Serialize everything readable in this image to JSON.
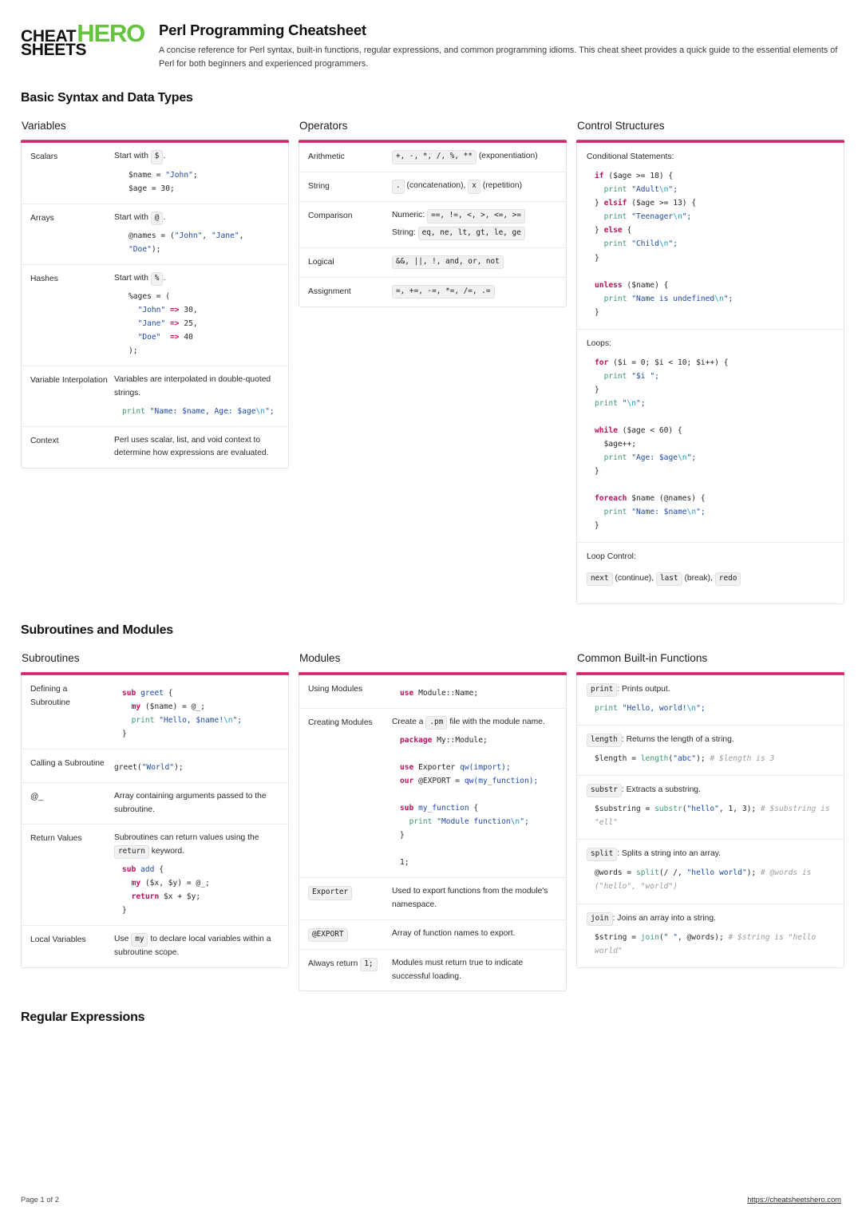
{
  "brand": {
    "logo_line1_dark": "CHEAT",
    "logo_line2_dark": "SHEETS",
    "logo_hero": "HERO",
    "green": "#66c340",
    "accent": "#cf1665"
  },
  "header": {
    "title": "Perl Programming Cheatsheet",
    "subtitle": "A concise reference for Perl syntax, built-in functions, regular expressions, and common programming idioms. This cheat sheet provides a quick guide to the essential elements of Perl for both beginners and experienced programmers."
  },
  "sections": [
    {
      "title": "Basic Syntax and Data Types"
    },
    {
      "title": "Subroutines and Modules"
    },
    {
      "title": "Regular Expressions"
    }
  ],
  "cards": {
    "variables": {
      "title": "Variables",
      "rows": {
        "scalars": {
          "label": "Scalars",
          "lead_prefix": "Start with",
          "lead_badge": "$",
          "lead_suffix": ".",
          "code_line1_var": "$name = ",
          "code_line1_str": "\"John\"",
          "code_line1_end": ";",
          "code_line2": "$age = 30;"
        },
        "arrays": {
          "label": "Arrays",
          "lead_prefix": "Start with",
          "lead_badge": "@",
          "lead_suffix": ".",
          "code_pre": "@names = (",
          "s1": "\"John\"",
          "sep1": ", ",
          "s2": "\"Jane\"",
          "sep2": ",",
          "s3": "\"Doe\"",
          "code_end": ");"
        },
        "hashes": {
          "label": "Hashes",
          "lead_prefix": "Start with",
          "lead_badge": "%",
          "lead_suffix": ".",
          "open": "%ages = (",
          "k1": "\"John\"",
          "v1": "30,",
          "k2": "\"Jane\"",
          "v2": "25,",
          "k3": "\"Doe\"",
          "v3": "40",
          "arrow": "=>",
          "close": ");"
        },
        "interpolation": {
          "label": "Variable Interpolation",
          "text": "Variables are interpolated in double-quoted strings.",
          "code_fn": "print",
          "code_str_a": "\"Name: $name, Age: $age",
          "code_esc": "\\n",
          "code_str_b": "\";"
        },
        "context": {
          "label": "Context",
          "text": "Perl uses scalar, list, and void context to determine how expressions are evaluated."
        }
      }
    },
    "operators": {
      "title": "Operators",
      "rows": {
        "arithmetic": {
          "label": "Arithmetic",
          "badge": "+, -, *, /, %, **",
          "after": "(exponentiation)"
        },
        "string": {
          "label": "String",
          "badge1": ".",
          "mid": "(concatenation),",
          "badge2": "x",
          "after": "(repetition)"
        },
        "comparison": {
          "label": "Comparison",
          "numeric_label": "Numeric:",
          "numeric_badge": "==, !=, <, >, <=, >=",
          "string_label": "String:",
          "string_badge": "eq, ne, lt, gt, le, ge"
        },
        "logical": {
          "label": "Logical",
          "badge": "&&, ||, !, and, or, not"
        },
        "assignment": {
          "label": "Assignment",
          "badge": "=, +=, -=, *=, /=, .="
        }
      }
    },
    "control": {
      "title": "Control Structures",
      "conditional": {
        "label": "Conditional Statements:",
        "if_kw": "if",
        "if_cond": " ($age >= 18) {",
        "p1_fn": "print",
        "p1_str": "\"Adult",
        "p1_esc": "\\n",
        "p1_end": "\";",
        "elsif_pre": "} ",
        "elsif_kw": "elsif",
        "elsif_cond": " ($age >= 13) {",
        "p2_fn": "print",
        "p2_str": "\"Teenager",
        "p2_esc": "\\n",
        "p2_end": "\";",
        "else_pre": "} ",
        "else_kw": "else",
        "else_post": " {",
        "p3_fn": "print",
        "p3_str": "\"Child",
        "p3_esc": "\\n",
        "p3_end": "\";",
        "brace": "}",
        "unless_kw": "unless",
        "unless_cond": " ($name) {",
        "p4_fn": "print",
        "p4_str": "\"Name is undefined",
        "p4_esc": "\\n",
        "p4_end": "\";",
        "brace2": "}"
      },
      "loops": {
        "label": "Loops:",
        "for_kw": "for",
        "for_cond": " ($i = 0; $i < 10; $i++) {",
        "for_fn": "print",
        "for_str": "\"$i \";",
        "for_close": "}",
        "print_fn": "print",
        "print_str": "\"",
        "print_esc": "\\n",
        "print_end": "\";",
        "while_kw": "while",
        "while_cond": " ($age < 60) {",
        "while_inc": "$age++;",
        "while_fn": "print",
        "while_str": "\"Age: $age",
        "while_esc": "\\n",
        "while_end": "\";",
        "while_close": "}",
        "foreach_kw": "foreach",
        "foreach_cond": " $name (@names) {",
        "foreach_fn": "print",
        "foreach_str": "\"Name: $name",
        "foreach_esc": "\\n",
        "foreach_end": "\";",
        "foreach_close": "}"
      },
      "loop_control": {
        "label": "Loop Control:",
        "b1": "next",
        "t1": "(continue),",
        "b2": "last",
        "t2": "(break),",
        "b3": "redo"
      }
    },
    "subroutines": {
      "title": "Subroutines",
      "rows": {
        "defining": {
          "label": "Defining a Subroutine",
          "sub_kw": "sub",
          "sub_name": " greet",
          "sub_open": " {",
          "my_kw": "my",
          "my_rest": " ($name) = @_;",
          "print_fn": "print",
          "print_str": " \"Hello, $name!",
          "print_esc": "\\n",
          "print_end": "\";",
          "close": "}"
        },
        "calling": {
          "label": "Calling a Subroutine",
          "code_a": "greet(",
          "code_s": "\"World\"",
          "code_b": ");"
        },
        "underscore": {
          "label": "@_",
          "text": "Array containing arguments passed to the subroutine."
        },
        "return_values": {
          "label": "Return Values",
          "text_a": "Subroutines can return values using the",
          "badge": "return",
          "text_b": "keyword.",
          "sub_kw": "sub",
          "sub_name": " add",
          "sub_open": " {",
          "my_kw": "my",
          "my_rest": " ($x, $y) = @_;",
          "ret_kw": "return",
          "ret_rest": " $x + $y;",
          "close": "}"
        },
        "local_variables": {
          "label": "Local Variables",
          "text_a": "Use",
          "badge": "my",
          "text_b": "to declare local variables within a subroutine scope."
        }
      }
    },
    "modules": {
      "title": "Modules",
      "rows": {
        "using": {
          "label": "Using Modules",
          "use_kw": "use",
          "use_rest": " Module::Name;"
        },
        "creating": {
          "label": "Creating Modules",
          "text_a": "Create a",
          "badge": ".pm",
          "text_b": "file with the module name.",
          "package_kw": "package",
          "package_rest": " My::Module;",
          "use_kw": "use",
          "use_rest": " Exporter ",
          "use_qw": "qw(import);",
          "our_kw": "our",
          "our_rest": " @EXPORT = ",
          "our_qw": "qw(my_function);",
          "sub_kw": "sub",
          "sub_name": " my_function",
          "sub_open": " {",
          "print_fn": "print",
          "print_str": " \"Module function",
          "print_esc": "\\n",
          "print_end": "\";",
          "close": "}",
          "one": "1;"
        },
        "exporter": {
          "badge": "Exporter",
          "text": "Used to export functions from the module's namespace."
        },
        "export_array": {
          "badge": "@EXPORT",
          "text": "Array of function names to export."
        },
        "always_return": {
          "label_a": "Always return",
          "label_badge": "1;",
          "text": "Modules must return true to indicate successful loading."
        }
      }
    },
    "builtins": {
      "title": "Common Built-in Functions",
      "rows": [
        {
          "badge": "print",
          "desc": ": Prints output.",
          "code_fn": "print",
          "code_str": " \"Hello, world!",
          "code_esc": "\\n",
          "code_end": "\";"
        },
        {
          "badge": "length",
          "desc": ": Returns the length of a string.",
          "code_pre": "$length = ",
          "code_fn": "length",
          "code_mid": "(",
          "code_str": "\"abc\"",
          "code_post": "); ",
          "code_comment": "# $length is 3"
        },
        {
          "badge": "substr",
          "desc": ": Extracts a substring.",
          "code_pre": "$substring = ",
          "code_fn": "substr",
          "code_mid": "(",
          "code_str": "\"hello\"",
          "code_post": ", 1, 3); ",
          "code_comment": "# $substring is \"ell\""
        },
        {
          "badge": "split",
          "desc": ": Splits a string into an array.",
          "code_pre": "@words = ",
          "code_fn": "split",
          "code_mid": "(/ /, ",
          "code_str": "\"hello world\"",
          "code_post": "); ",
          "code_comment": "# @words is (\"hello\", \"world\")"
        },
        {
          "badge": "join",
          "desc": ": Joins an array into a string.",
          "code_pre": "$string = ",
          "code_fn": "join",
          "code_mid": "(",
          "code_str": "\" \"",
          "code_post": ", @words); ",
          "code_comment": "# $string is \"hello world\""
        }
      ]
    }
  },
  "footer": {
    "page": "Page 1 of 2",
    "url": "https://cheatsheetshero.com"
  }
}
